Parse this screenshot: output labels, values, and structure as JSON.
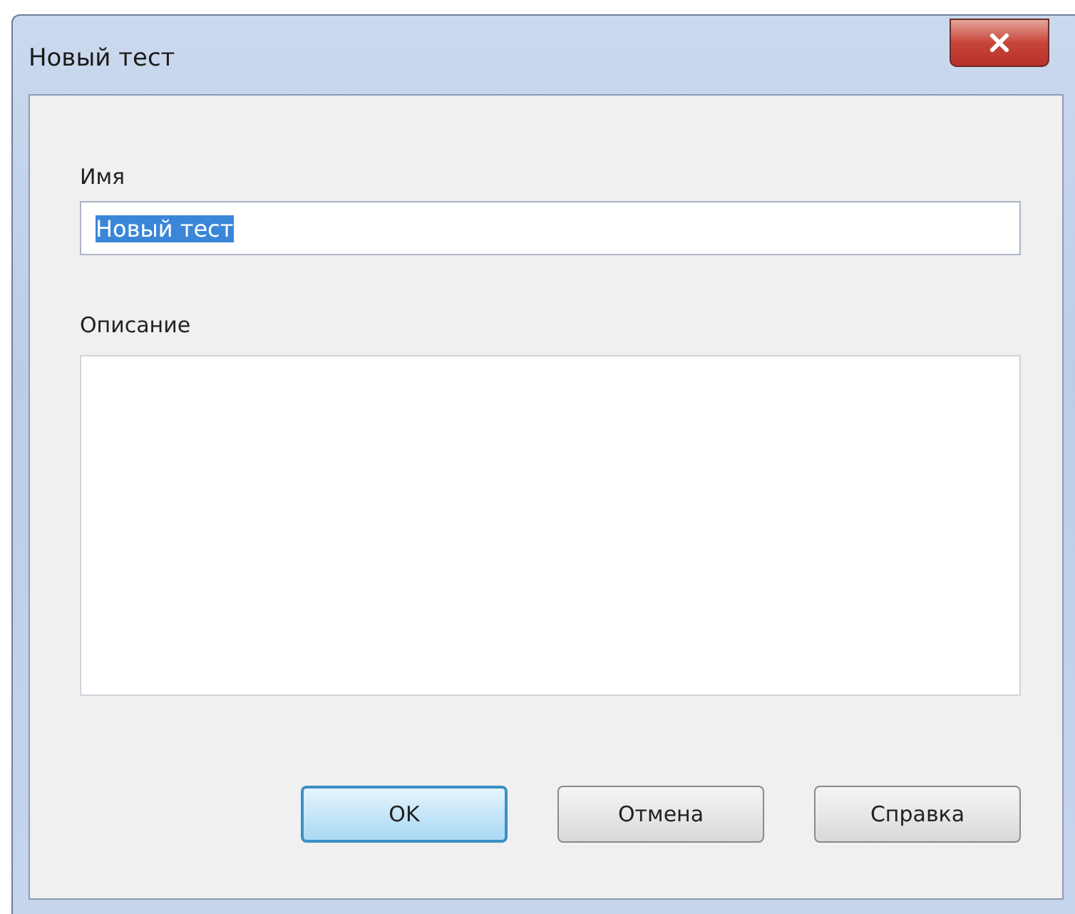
{
  "window": {
    "title": "Новый тест"
  },
  "name_field": {
    "label": "Имя",
    "value": "Новый тест",
    "text_selected": true
  },
  "description_field": {
    "label": "Описание"
  },
  "buttons": [
    {
      "label": "OK",
      "default": true
    },
    {
      "label": "Отмена",
      "default": false
    },
    {
      "label": "Справка",
      "default": false
    }
  ]
}
